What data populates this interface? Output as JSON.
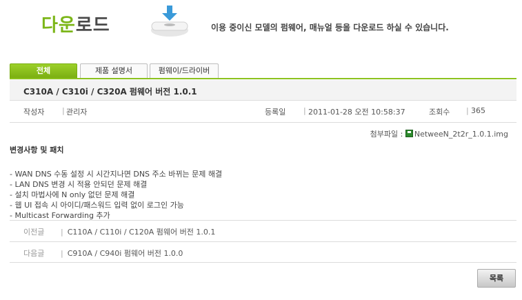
{
  "header": {
    "logo_green": "다운",
    "logo_dark": "로드",
    "icon": "download-icon",
    "description": "이용 중이신 모델의 펌웨어, 매뉴얼 등을 다운로드 하실 수 있습니다."
  },
  "tabs": [
    {
      "label": "전체",
      "active": true
    },
    {
      "label": "제품 설명서",
      "active": false
    },
    {
      "label": "펌웨이/드라이버",
      "active": false
    }
  ],
  "post": {
    "title": "C310A / C310i / C320A 펌웨어 버전 1.0.1",
    "author_label": "작성자",
    "author": "관리자",
    "date_label": "등록일",
    "date": "2011-01-28 오전 10:58:37",
    "views_label": "조회수",
    "views": "365",
    "attachment_label": "첨부파일 :",
    "attachment_icon": "floppy-disk-icon",
    "attachment_name": "NetweeN_2t2r_1.0.1.img",
    "content_title": "변경사항 및 패치",
    "changes": [
      "- WAN DNS 수동 설정 시 시간지나면 DNS 주소 바뀌는 문제 해결",
      "- LAN DNS 변경 시 적용 안되던 문제 해결",
      "- 설치 마법사에 N only 없던 문제 해결",
      "- 웹 UI 접속 시 아이디/패스워드 입력 없이 로그인 가능",
      "- Multicast Forwarding 추가"
    ]
  },
  "prev": {
    "label": "이전글",
    "title": "C110A / C110i / C120A 펌웨어 버전 1.0.1"
  },
  "next": {
    "label": "다음글",
    "title": "C910A / C940i 펌웨어 버전 1.0.0"
  },
  "list_button": "목록",
  "colors": {
    "accent": "#8cc21f",
    "tab_active": "#79ad10"
  }
}
